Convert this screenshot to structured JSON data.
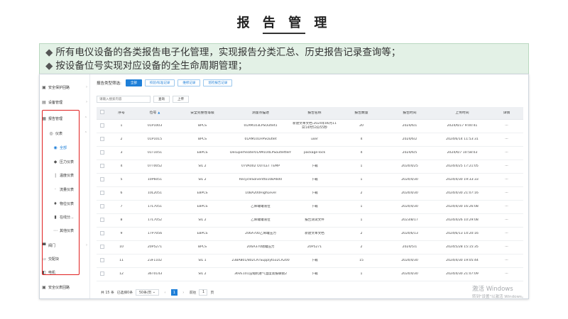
{
  "slide": {
    "title": "报 告 管 理",
    "bullets": [
      "所有电仪设备的各类报告电子化管理，实现报告分类汇总、历史报告记录查询等；",
      "按设备位号实现对应设备的全生命周期管理；"
    ]
  },
  "sidebar": {
    "items": [
      {
        "icon": "shield-icon",
        "label": "安全保护回路",
        "chevron": "›"
      },
      {
        "icon": "device-icon",
        "label": "设备管理",
        "chevron": "›"
      },
      {
        "icon": "report-icon",
        "label": "报告管理",
        "chevron": "⌃"
      },
      {
        "icon": "instrument-icon",
        "label": "仪表",
        "chevron": "⌃"
      },
      {
        "icon": "all-icon",
        "label": "全部"
      },
      {
        "icon": "pressure-icon",
        "label": "压力仪表"
      },
      {
        "icon": "temperature-icon",
        "label": "温度仪表"
      },
      {
        "icon": "flow-icon",
        "label": "流量仪表"
      },
      {
        "icon": "level-icon",
        "label": "物位仪表"
      },
      {
        "icon": "analyzer-icon",
        "label": "在线分..."
      },
      {
        "icon": "other-icon",
        "label": "其他仪表"
      },
      {
        "icon": "valve-icon",
        "label": "阀门",
        "chevron": "›"
      },
      {
        "icon": "electric-icon",
        "label": "交配块"
      },
      {
        "icon": "motor-icon",
        "label": "电机"
      },
      {
        "icon": "safety-loop-icon",
        "label": "安全仪表回路"
      }
    ]
  },
  "filter": {
    "label": "报告类型筛选:",
    "buttons": [
      "全部",
      "校验/标准记录",
      "维修记录",
      "巡检报告记录"
    ]
  },
  "search": {
    "placeholder": "请输入搜索内容",
    "query_label": "查询",
    "upload_label": "上传"
  },
  "table": {
    "columns": [
      "序号",
      "位号",
      "安全完整性等级",
      "测量点描述",
      "报告名称",
      "报告数量",
      "报告时间",
      "上传时间",
      "详情"
    ],
    "sort_indicator": "▲",
    "rows": [
      {
        "no": "1",
        "tag": "01P1003",
        "sil": "BPCS",
        "desc": "01AM103LPSOutlet1",
        "name": "新建文本文档-2024年06月11日14时53分55秒",
        "count": "20",
        "report_time": "2024/6/1",
        "upload_time": "2024/6/17 9:00:41",
        "detail": "···"
      },
      {
        "no": "2",
        "tag": "01P1015",
        "sil": "BPCS",
        "desc": "01AM101HPSOutlet",
        "name": "user",
        "count": "4",
        "report_time": "2024/6/2",
        "upload_time": "2024/6/14 11:53:31",
        "detail": "···"
      },
      {
        "no": "3",
        "tag": "01T1051",
        "sil": "EBPCS",
        "desc": "Desuperheater01AM104LPSoutlettemperature",
        "name": "package-lock",
        "count": "4",
        "report_time": "2024/6/5",
        "upload_time": "2024/6/7 10:58:03",
        "detail": "···"
      },
      {
        "no": "4",
        "tag": "07T0052",
        "sil": "SIL 2",
        "desc": "07VA002 OUTLET TEMP",
        "name": "下载",
        "count": "1",
        "report_time": "2024/4/25",
        "upload_time": "2024/4/25 17:21:05",
        "detail": "···"
      },
      {
        "no": "5",
        "tag": "10P6051",
        "sil": "SIL 2",
        "desc": "RecycleSolventto10BA600",
        "name": "下载",
        "count": "1",
        "report_time": "2024/4/30",
        "upload_time": "2024/4/30 19:33:33",
        "detail": "···"
      },
      {
        "no": "6",
        "tag": "10L2051",
        "sil": "EBPCS",
        "desc": "10BA200HighLevel",
        "name": "下载",
        "count": "2",
        "report_time": "2024/4/30",
        "upload_time": "2024/4/30 21:07:16",
        "detail": "···"
      },
      {
        "no": "7",
        "tag": "17L7051",
        "sil": "EBPCS",
        "desc": "乙烯罐罐液位",
        "name": "下载",
        "count": "1",
        "report_time": "2024/4/30",
        "upload_time": "2024/4/30 16:26:08",
        "detail": "···"
      },
      {
        "no": "8",
        "tag": "17L7052",
        "sil": "SIL 2",
        "desc": "乙烯罐罐液位",
        "name": "报告测试文件",
        "count": "1",
        "report_time": "2023/8/17",
        "upload_time": "2024/4/26 10:29:08",
        "detail": "···"
      },
      {
        "no": "9",
        "tag": "17P7056",
        "sil": "EBPCS",
        "desc": "206A700乙烯罐压力",
        "name": "新建文本文档",
        "count": "2",
        "report_time": "2024/6/13",
        "upload_time": "2024/6/13 14:20:16",
        "detail": "···"
      },
      {
        "no": "10",
        "tag": "20P5271",
        "sil": "BPCS",
        "desc": "206A370储罐压力",
        "name": "20P5271",
        "count": "2",
        "report_time": "2024/5/1",
        "upload_time": "2024/5/28 15:15:35",
        "detail": "···"
      },
      {
        "no": "11",
        "tag": "23F1102",
        "sil": "SIL 1",
        "desc": "23BA801/802CATSupplyto32CA200",
        "name": "下载",
        "count": "15",
        "report_time": "2024/4/30",
        "upload_time": "2024/4/30 19:05:44",
        "detail": "···"
      },
      {
        "no": "12",
        "tag": "36T0143",
        "sil": "SIL 2",
        "desc": "36VE101压缩机进气温度高报联锁2",
        "name": "下载",
        "count": "1",
        "report_time": "2024/4/30",
        "upload_time": "2024/4/30 21:07:09",
        "detail": "···"
      }
    ]
  },
  "pagination": {
    "total": "共 15 条",
    "selected": "已选择0条",
    "page_size": "50条/页",
    "prev": "‹",
    "current": "1",
    "next": "›",
    "goto_label": "前往",
    "goto_value": "1",
    "page_unit": "页"
  },
  "watermark": {
    "line1": "激活 Windows",
    "line2": "转到\"设置\"以激活 Windows。"
  },
  "colors": {
    "accent": "#1e7fd8",
    "highlight_border": "#e02020",
    "description_background": "#e3f1e6"
  }
}
